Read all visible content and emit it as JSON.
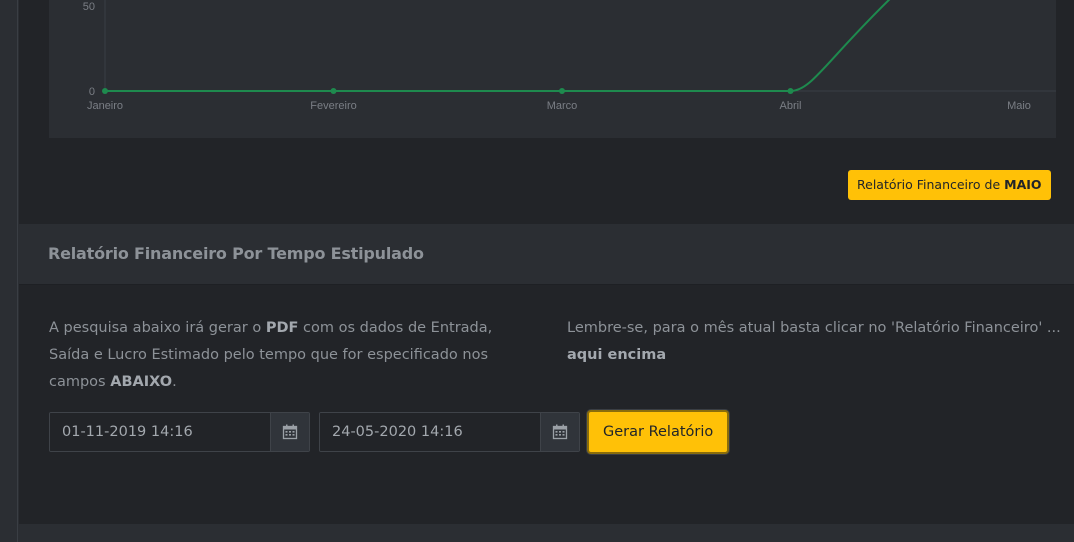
{
  "chart_data": {
    "type": "line",
    "categories": [
      "Janeiro",
      "Fevereiro",
      "Marco",
      "Abril",
      "Maio"
    ],
    "y_ticks": [
      "0",
      "50"
    ],
    "values": [
      0,
      0,
      0,
      0,
      120
    ],
    "ylim": [
      0,
      100
    ],
    "colors": {
      "line": "#1e8a4e",
      "grid": "#3a3e44"
    }
  },
  "month_report": {
    "label_prefix": "Relatório Financeiro de",
    "label_month": "MAIO"
  },
  "period_report": {
    "title": "Relatório Financeiro Por Tempo Estipulado",
    "left_text": {
      "p1": "A pesquisa abaixo irá gerar o",
      "b1": "PDF",
      "p2": " com os dados de Entrada, Saída e Lucro Estimado pelo tempo que for especificado nos campos",
      "b2": "ABAIXO",
      "p3": "."
    },
    "right_text": {
      "p1": "Lembre-se, para o mês atual basta clicar no 'Relatório Financeiro' ...",
      "b1": "aqui encima"
    },
    "start_date": "01-11-2019 14:16",
    "end_date": "24-05-2020 14:16",
    "calendar_icon": "calendar-icon",
    "submit_label": "Gerar Relatório"
  },
  "colors": {
    "accent": "#ffc107",
    "bg": "#222428",
    "panel": "#2b2e33"
  }
}
